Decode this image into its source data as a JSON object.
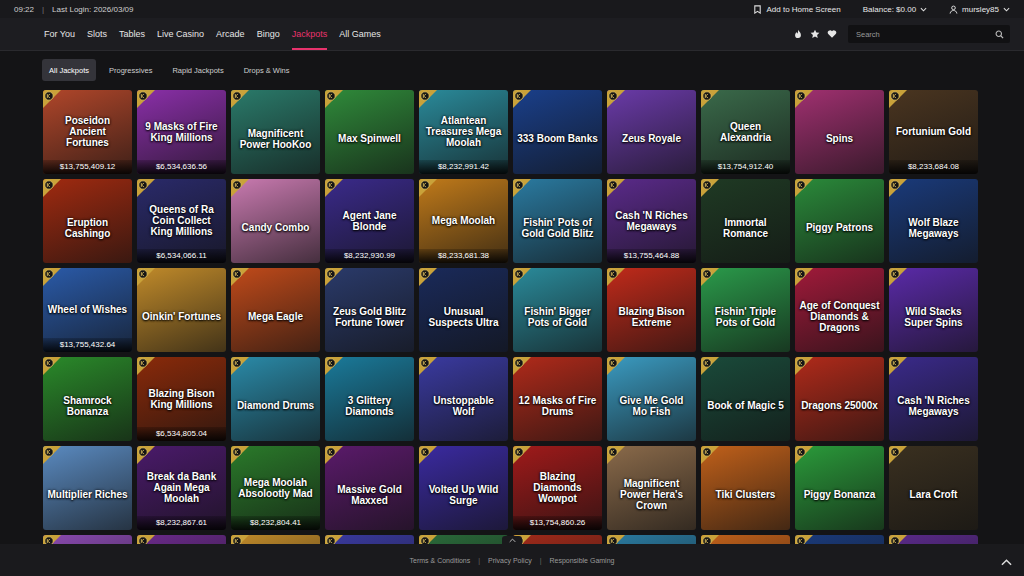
{
  "topbar": {
    "time": "09:22",
    "separator": "|",
    "last_login": "Last Login: 2026/03/09",
    "add_home": "Add to Home Screen",
    "balance": "Balance: $0.00",
    "username": "mursley85"
  },
  "nav": [
    {
      "label": "For You",
      "selected": false
    },
    {
      "label": "Slots",
      "selected": false
    },
    {
      "label": "Tables",
      "selected": false
    },
    {
      "label": "Live Casino",
      "selected": false
    },
    {
      "label": "Arcade",
      "selected": false
    },
    {
      "label": "Bingo",
      "selected": false
    },
    {
      "label": "Jackpots",
      "selected": true
    },
    {
      "label": "All Games",
      "selected": false
    }
  ],
  "search": {
    "placeholder": "Search"
  },
  "subtabs": [
    {
      "label": "All Jackpots",
      "selected": true
    },
    {
      "label": "Progressives",
      "selected": false
    },
    {
      "label": "Rapid Jackpots",
      "selected": false
    },
    {
      "label": "Drops & Wins",
      "selected": false
    }
  ],
  "games": [
    {
      "name": "Poseidon Ancient Fortunes",
      "jackpot": "$13,755,409.12",
      "color": "#b0462a"
    },
    {
      "name": "9 Masks of Fire King Millions",
      "jackpot": "$6,534,636.56",
      "color": "#8a2fa8"
    },
    {
      "name": "Magnificent Power HooKoo",
      "color": "#2a7a6a"
    },
    {
      "name": "Max Spinwell",
      "color": "#2f8a3a"
    },
    {
      "name": "Atlantean Treasures Mega Moolah",
      "jackpot": "$8,232,991.42",
      "color": "#2a8a9a"
    },
    {
      "name": "333 Boom Banks",
      "color": "#1a3f8a"
    },
    {
      "name": "Zeus Royale",
      "color": "#6a3aa8"
    },
    {
      "name": "Queen Alexandria",
      "jackpot": "$13,754,912.40",
      "color": "#3a6a4a"
    },
    {
      "name": "Spins",
      "color": "#a03070"
    },
    {
      "name": "Fortunium Gold",
      "jackpot": "$8,233,684.08",
      "color": "#4a3520"
    },
    {
      "name": "Eruption Cashingo",
      "color": "#a02a10"
    },
    {
      "name": "Queens of Ra Coin Collect King Millions",
      "jackpot": "$6,534,066.11",
      "color": "#2a2a6a"
    },
    {
      "name": "Candy Combo",
      "color": "#c97ab0"
    },
    {
      "name": "Agent Jane Blonde",
      "jackpot": "$8,232,930.99",
      "color": "#3a2a8a"
    },
    {
      "name": "Mega Moolah",
      "jackpot": "$8,233,681.38",
      "color": "#c07a1a"
    },
    {
      "name": "Fishin' Pots of Gold Gold Blitz",
      "color": "#2a7aa0"
    },
    {
      "name": "Cash 'N Riches Megaways",
      "jackpot": "$13,755,464.88",
      "color": "#5a2a8a"
    },
    {
      "name": "Immortal Romance",
      "color": "#1f3a24"
    },
    {
      "name": "Piggy Patrons",
      "color": "#2a8a3a"
    },
    {
      "name": "Wolf Blaze Megaways",
      "color": "#1a3a7a"
    },
    {
      "name": "Wheel of Wishes",
      "jackpot": "$13,755,432.64",
      "color": "#2a5aa8"
    },
    {
      "name": "Oinkin' Fortunes",
      "color": "#c08a2a"
    },
    {
      "name": "Mega Eagle",
      "color": "#c04a1a"
    },
    {
      "name": "Zeus Gold Blitz Fortune Tower",
      "color": "#2a3a6a"
    },
    {
      "name": "Unusual Suspects Ultra",
      "color": "#1a2a5a"
    },
    {
      "name": "Fishin' Bigger Pots of Gold",
      "color": "#2a8a9a"
    },
    {
      "name": "Blazing Bison Extreme",
      "color": "#c02a1a"
    },
    {
      "name": "Fishin' Triple Pots of Gold",
      "color": "#2a9a4a"
    },
    {
      "name": "Age of Conquest Diamonds & Dragons",
      "color": "#a01a3a"
    },
    {
      "name": "Wild Stacks Super Spins",
      "color": "#5a2aa8"
    },
    {
      "name": "Shamrock Bonanza",
      "color": "#2a8a2a"
    },
    {
      "name": "Blazing Bison King Millions",
      "jackpot": "$6,534,805.04",
      "color": "#8a2a0a"
    },
    {
      "name": "Diamond Drums",
      "color": "#2a8aa8"
    },
    {
      "name": "3 Glittery Diamonds",
      "color": "#1a7a9a"
    },
    {
      "name": "Unstoppable Wolf",
      "color": "#3a3aa0"
    },
    {
      "name": "12 Masks of Fire Drums",
      "color": "#b02a1a"
    },
    {
      "name": "Give Me Gold Mo Fish",
      "color": "#3a9ac0"
    },
    {
      "name": "Book of Magic 5",
      "color": "#1a4a3a"
    },
    {
      "name": "Dragons 25000x",
      "color": "#b02a1a"
    },
    {
      "name": "Cash 'N Riches Megaways",
      "color": "#3a2a8a"
    },
    {
      "name": "Multiplier Riches",
      "color": "#5a8ac0"
    },
    {
      "name": "Break da Bank Again Mega Moolah",
      "jackpot": "$8,232,867.61",
      "color": "#4a1a6a"
    },
    {
      "name": "Mega Moolah Absolootly Mad",
      "jackpot": "$8,232,804.41",
      "color": "#2a7a2a"
    },
    {
      "name": "Massive Gold Maxxed",
      "color": "#5a1a6a"
    },
    {
      "name": "Volted Up Wild Surge",
      "color": "#3a2aa0"
    },
    {
      "name": "Blazing Diamonds Wowpot",
      "jackpot": "$13,754,860.26",
      "color": "#a01a1a"
    },
    {
      "name": "Magnificent Power Hera's Crown",
      "color": "#8a6a4a"
    },
    {
      "name": "Tiki Clusters",
      "color": "#c0601a"
    },
    {
      "name": "Piggy Bonanza",
      "color": "#2a9a3a"
    },
    {
      "name": "Lara Croft",
      "color": "#3a3020"
    },
    {
      "color": "#8a4ab0"
    },
    {
      "color": "#6a2a8a"
    },
    {
      "color": "#c08a2a"
    },
    {
      "color": "#3a3aa0"
    },
    {
      "color": "#2a6a3a"
    },
    {
      "color": "#a02a1a"
    },
    {
      "color": "#2a7aa0"
    },
    {
      "color": "#c0601a"
    },
    {
      "color": "#1a3a7a"
    },
    {
      "color": "#5a2a8a"
    }
  ],
  "footer": {
    "links": [
      "Terms & Conditions",
      "Privacy Policy",
      "Responsible Gaming"
    ],
    "separator": "|"
  }
}
